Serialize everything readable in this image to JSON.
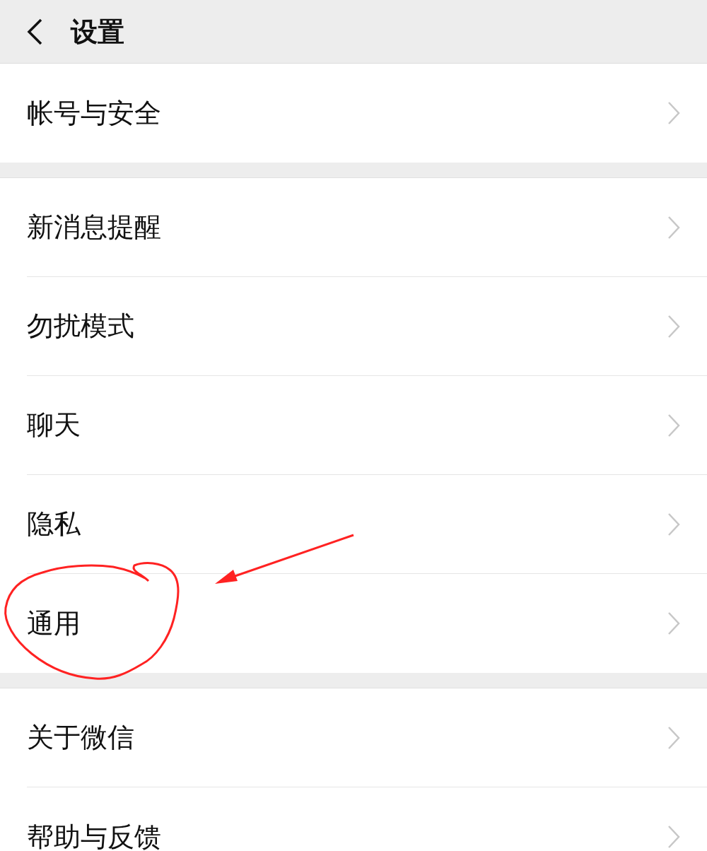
{
  "header": {
    "title": "设置"
  },
  "groups": [
    {
      "items": [
        {
          "label": "帐号与安全"
        }
      ]
    },
    {
      "items": [
        {
          "label": "新消息提醒"
        },
        {
          "label": "勿扰模式"
        },
        {
          "label": "聊天"
        },
        {
          "label": "隐私"
        },
        {
          "label": "通用"
        }
      ]
    },
    {
      "items": [
        {
          "label": "关于微信"
        },
        {
          "label": "帮助与反馈"
        }
      ]
    }
  ],
  "annotations": [
    {
      "kind": "circle"
    },
    {
      "kind": "arrow"
    }
  ]
}
